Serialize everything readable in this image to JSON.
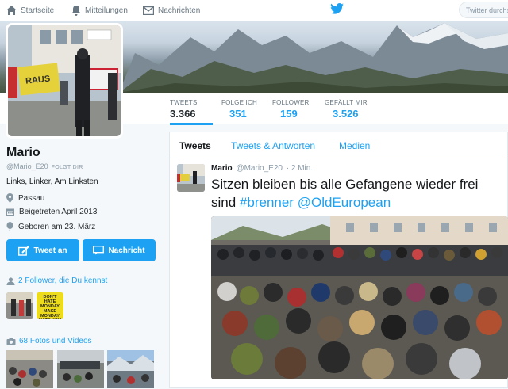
{
  "nav": {
    "home": "Startseite",
    "notifications": "Mitteilungen",
    "messages": "Nachrichten",
    "search_placeholder": "Twitter durchsuchen"
  },
  "stats": [
    {
      "label": "TWEETS",
      "value": "3.366"
    },
    {
      "label": "FOLGE ICH",
      "value": "351"
    },
    {
      "label": "FOLLOWER",
      "value": "159"
    },
    {
      "label": "GEFÄLLT MIR",
      "value": "3.526"
    }
  ],
  "profile": {
    "name": "Mario",
    "handle": "@Mario_E20",
    "follows_you": "FOLGT DIR",
    "bio": "Links, Linker, Am Linksten",
    "location": "Passau",
    "joined": "Beigetreten April 2013",
    "birthday": "Geboren am 23. März"
  },
  "actions": {
    "tweet_to": "Tweet an",
    "message": "Nachricht"
  },
  "sidebar": {
    "followers_you_know": "2 Follower, die Du kennst",
    "photos_videos": "68 Fotos und Videos",
    "sign_text": "DON'T HATE MONDAY MAKE MONDAY HATE YOU"
  },
  "avatar_sign": "RAUS",
  "timeline": {
    "tabs": [
      "Tweets",
      "Tweets & Antworten",
      "Medien"
    ]
  },
  "tweet": {
    "name": "Mario",
    "handle": "@Mario_E20",
    "time": "· 2 Min.",
    "text": "Sitzen bleiben bis alle Gefangene wieder frei sind ",
    "tag1": "#brenner",
    "mention": "@OldEuropean"
  },
  "colors": {
    "accent": "#1da1f2",
    "text": "#14171a",
    "muted": "#8899a6"
  }
}
